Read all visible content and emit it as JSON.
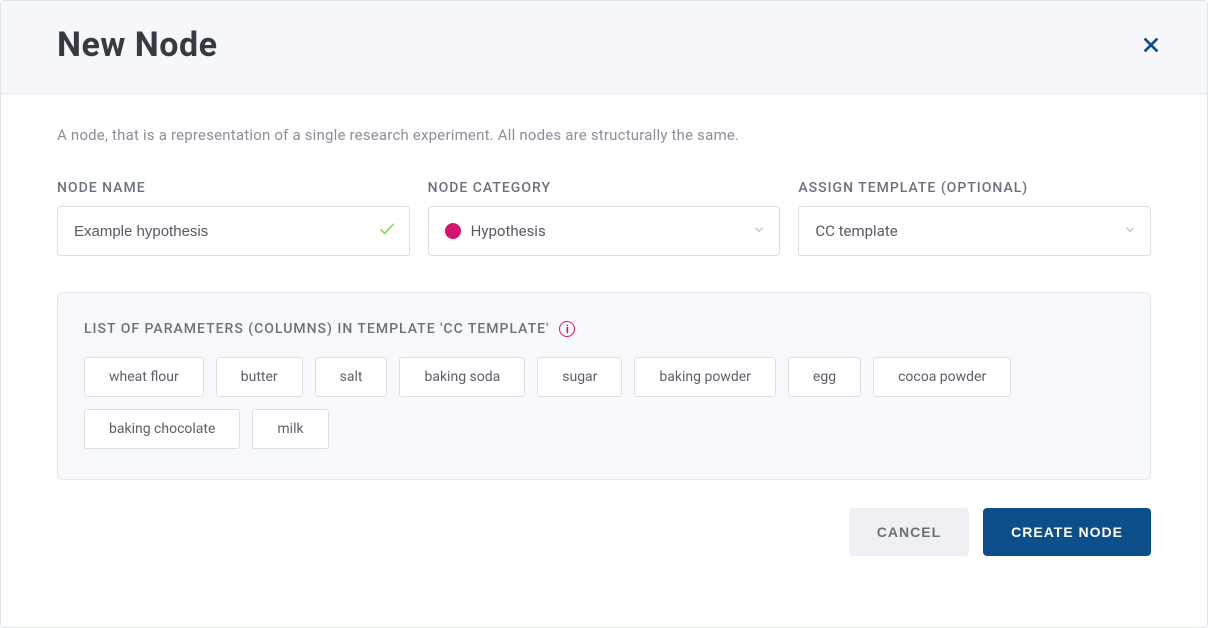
{
  "header": {
    "title": "New Node"
  },
  "description": "A node, that is a representation of a single research experiment. All nodes are structurally the same.",
  "form": {
    "nodeName": {
      "label": "NODE NAME",
      "value": "Example hypothesis"
    },
    "nodeCategory": {
      "label": "NODE CATEGORY",
      "value": "Hypothesis",
      "color": "#d6136e"
    },
    "template": {
      "label": "ASSIGN TEMPLATE (OPTIONAL)",
      "value": "CC template"
    }
  },
  "params": {
    "title": "LIST OF PARAMETERS (COLUMNS) IN TEMPLATE 'CC template'",
    "items": [
      "wheat flour",
      "butter",
      "salt",
      "baking soda",
      "sugar",
      "baking powder",
      "egg",
      "cocoa powder",
      "baking chocolate",
      "milk"
    ]
  },
  "footer": {
    "cancel": "CANCEL",
    "submit": "CREATE NODE"
  }
}
